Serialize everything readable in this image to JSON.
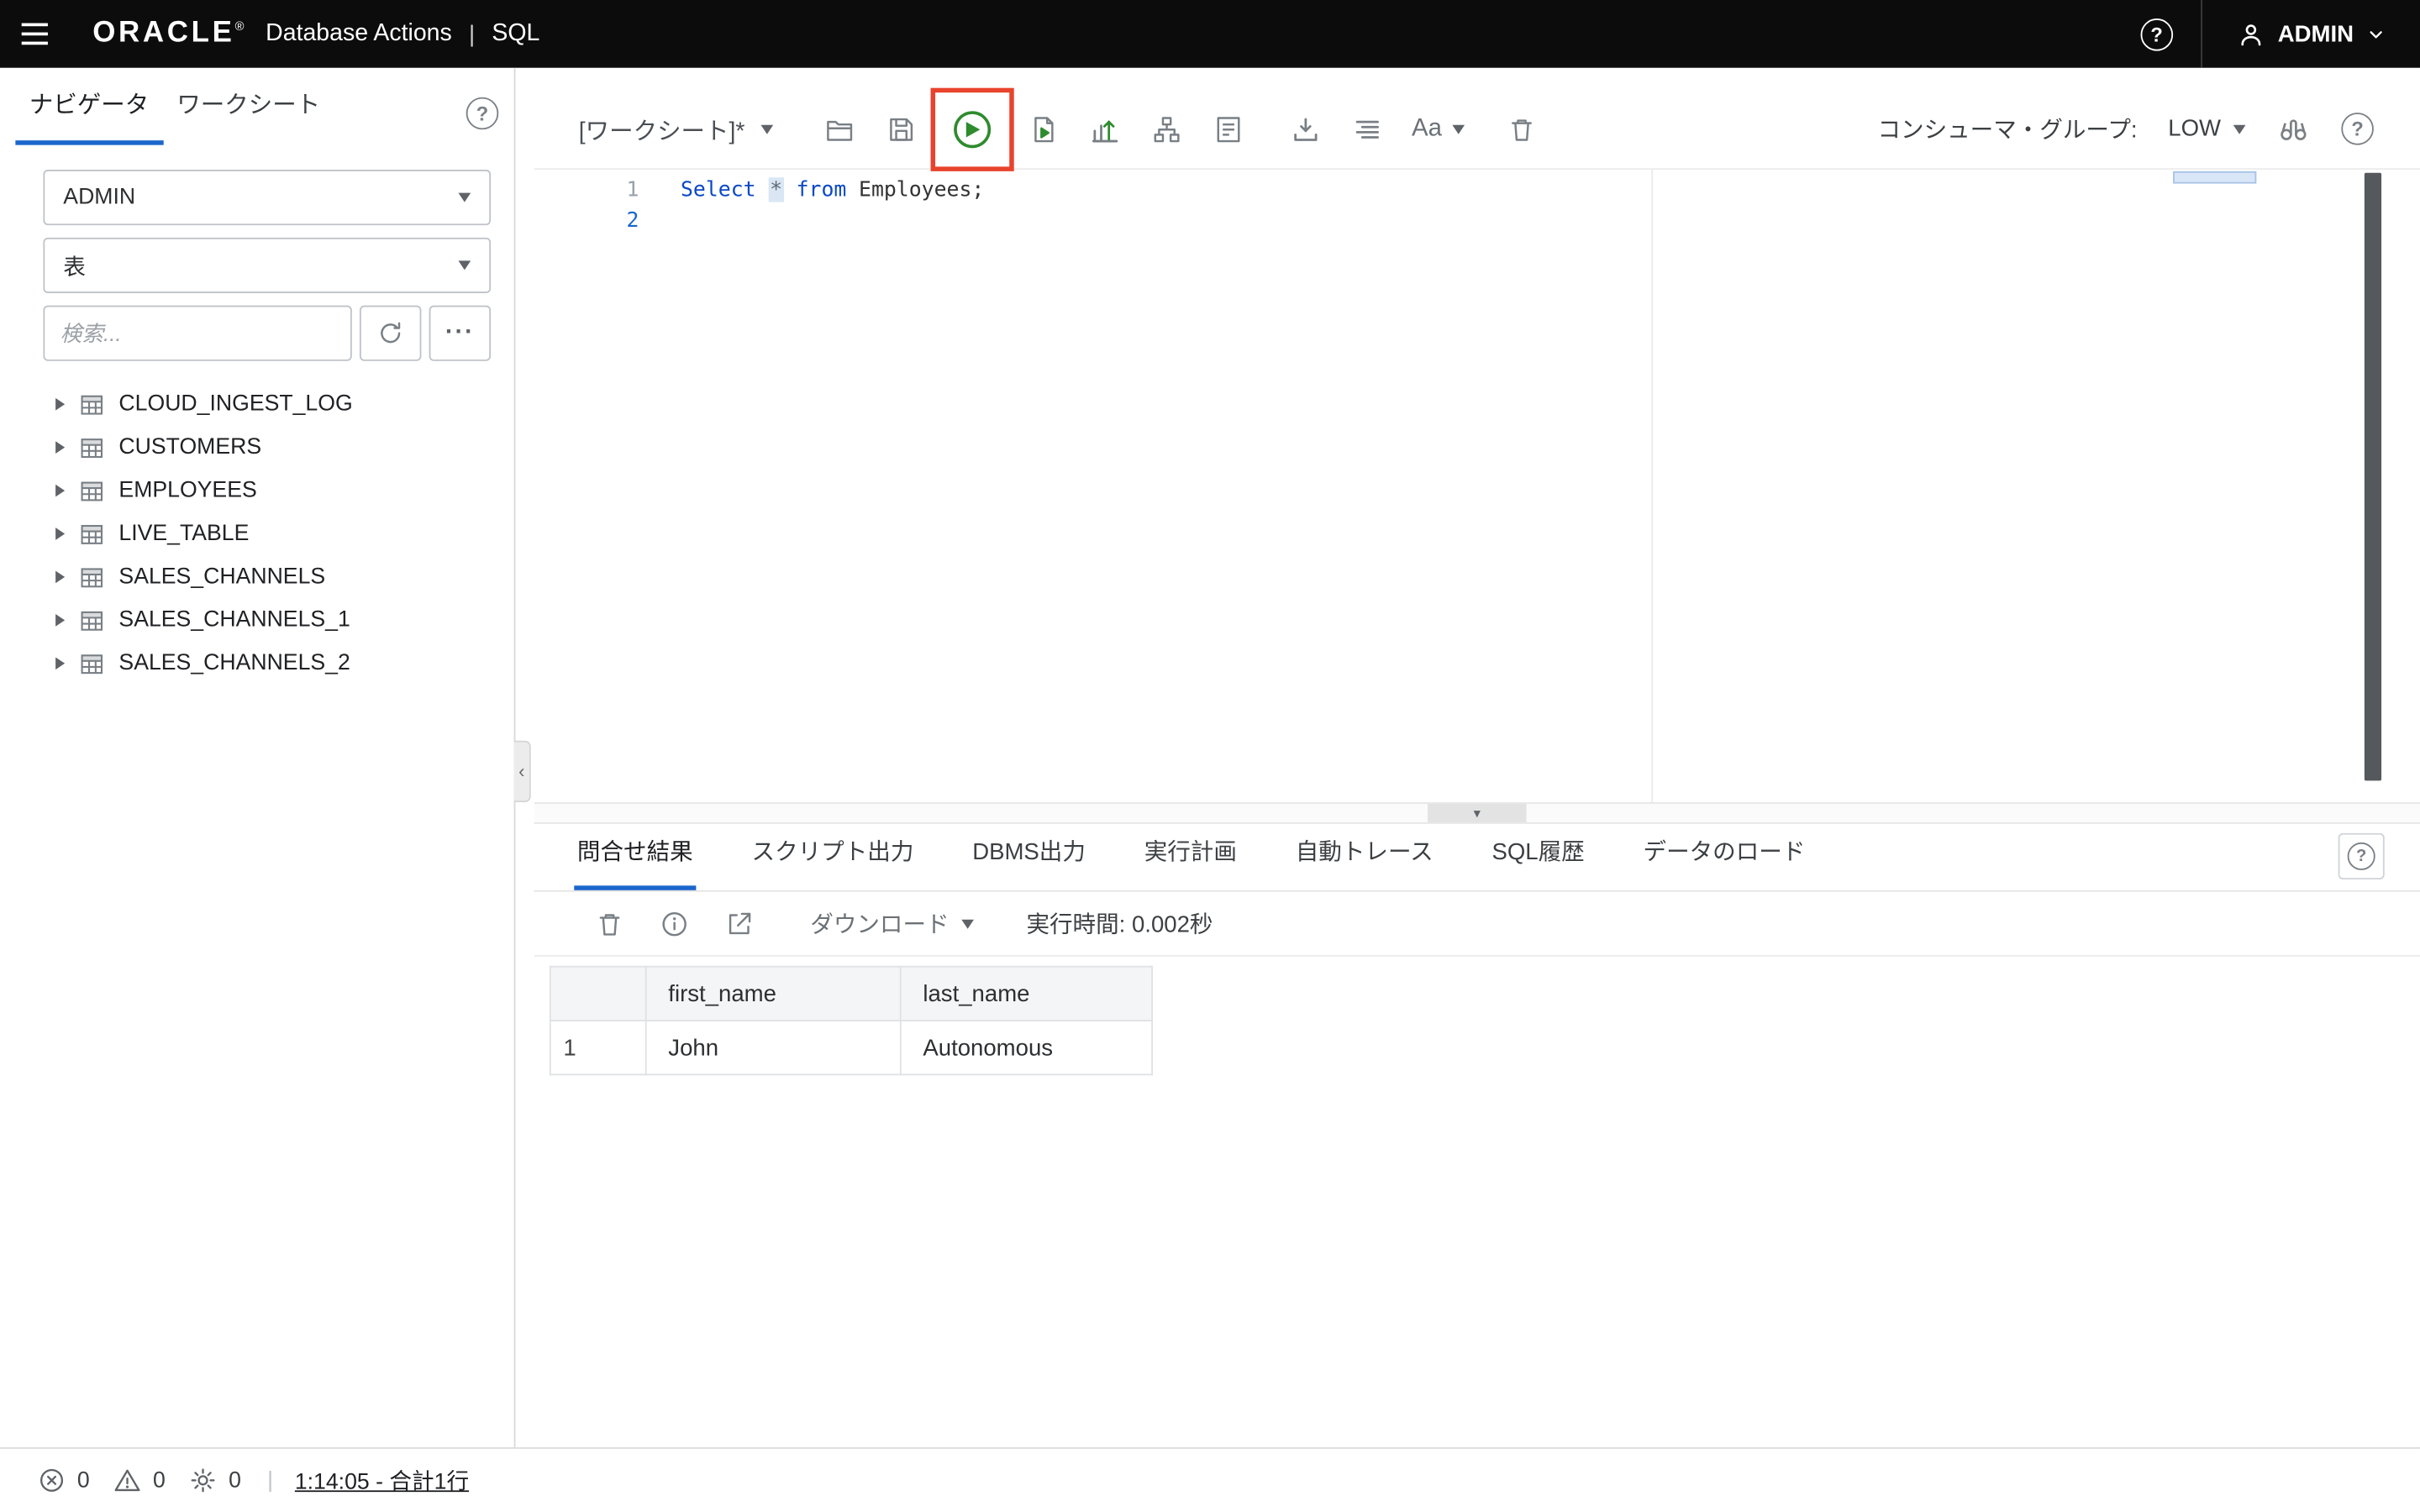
{
  "topbar": {
    "brand": "ORACLE",
    "brand_mark": "®",
    "product": "Database Actions",
    "divider": "|",
    "app": "SQL",
    "user_label": "ADMIN"
  },
  "sidebar": {
    "tab_navigator": "ナビゲータ",
    "tab_worksheet": "ワークシート",
    "schema_value": "ADMIN",
    "object_type_value": "表",
    "search_placeholder": "検索...",
    "tree_items": [
      "CLOUD_INGEST_LOG",
      "CUSTOMERS",
      "EMPLOYEES",
      "LIVE_TABLE",
      "SALES_CHANNELS",
      "SALES_CHANNELS_1",
      "SALES_CHANNELS_2"
    ]
  },
  "toolbar": {
    "worksheet_title": "[ワークシート]*",
    "font_button": "Aa",
    "consumer_group_label": "コンシューマ・グループ:",
    "consumer_group_value": "LOW"
  },
  "editor": {
    "line_numbers": [
      "1",
      "2"
    ],
    "code": {
      "kw_select": "Select",
      "star": "*",
      "kw_from": "from",
      "identifier": "Employees;"
    }
  },
  "results": {
    "tabs": [
      "問合せ結果",
      "スクリプト出力",
      "DBMS出力",
      "実行計画",
      "自動トレース",
      "SQL履歴",
      "データのロード"
    ],
    "download_label": "ダウンロード",
    "exec_time": "実行時間: 0.002秒",
    "grid": {
      "columns": [
        "",
        "first_name",
        "last_name"
      ],
      "rows": [
        [
          "1",
          "John",
          "Autonomous"
        ]
      ]
    }
  },
  "statusbar": {
    "errors": "0",
    "warnings": "0",
    "tasks": "0",
    "divider": "|",
    "summary_link": "1:14:05 - 合計1行"
  },
  "colors": {
    "accent_blue": "#1a66cc",
    "run_green": "#2e8b2e",
    "annotation_red": "#e8432c",
    "topbar_black": "#0c0c0c"
  }
}
